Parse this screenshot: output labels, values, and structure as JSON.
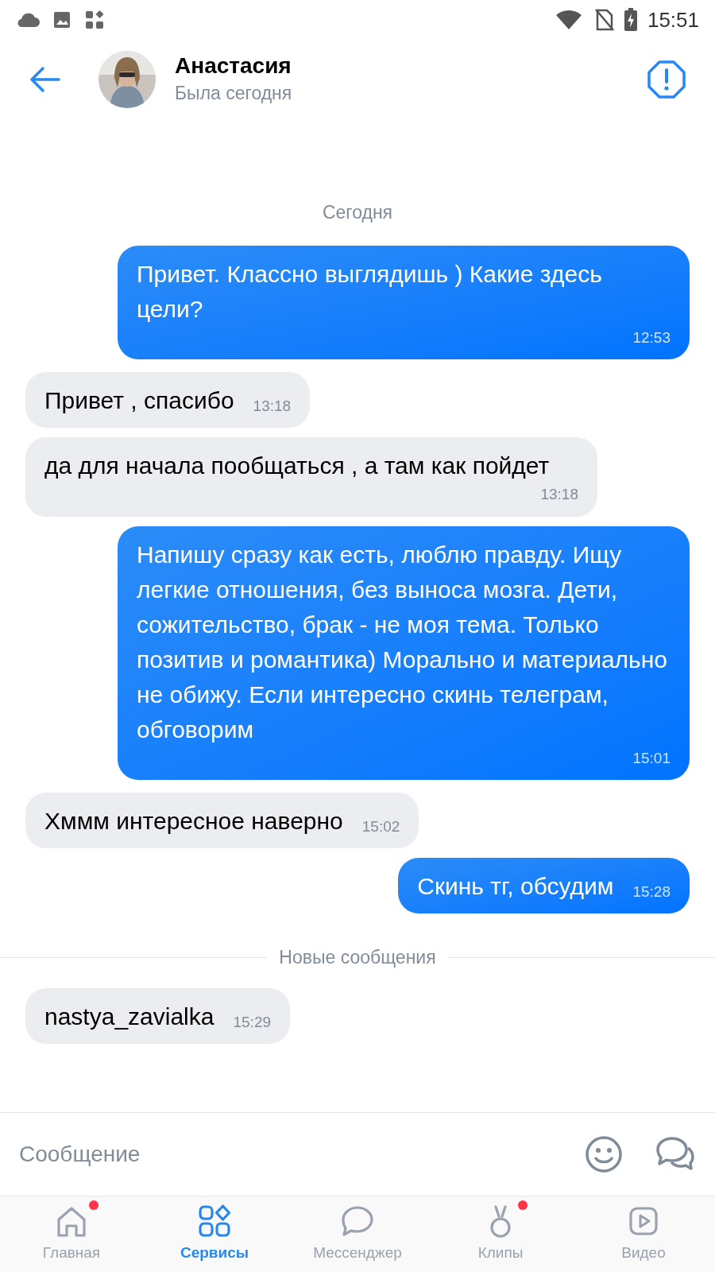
{
  "status_bar": {
    "time": "15:51"
  },
  "header": {
    "name": "Анастасия",
    "status": "Была сегодня"
  },
  "feed": [
    {
      "kind": "date",
      "text": "Сегодня"
    },
    {
      "kind": "out",
      "text": "Привет. Классно выглядишь ) Какие здесь цели?",
      "time": "12:53"
    },
    {
      "kind": "in",
      "text": "Привет , спасибо",
      "time": "13:18"
    },
    {
      "kind": "in",
      "text": "да для начала пообщаться , а там как пойдет",
      "time": "13:18"
    },
    {
      "kind": "out",
      "text": "Напишу сразу как есть, люблю правду. Ищу легкие отношения, без выноса мозга. Дети, сожительство, брак - не моя тема. Только позитив и романтика) Морально и материально не обижу. Если интересно скинь телеграм, обговорим",
      "time": "15:01"
    },
    {
      "kind": "in",
      "text": "Хммм интересное наверно",
      "time": "15:02"
    },
    {
      "kind": "out",
      "text": "Скинь тг, обсудим",
      "time": "15:28"
    },
    {
      "kind": "divider",
      "text": "Новые сообщения"
    },
    {
      "kind": "in",
      "text": "nastya_zavialka",
      "time": "15:29"
    }
  ],
  "composer": {
    "placeholder": "Сообщение"
  },
  "nav": [
    {
      "label": "Главная",
      "kind": "home",
      "selected": false,
      "badge": true
    },
    {
      "label": "Сервисы",
      "kind": "services",
      "selected": true,
      "badge": false
    },
    {
      "label": "Мессенджер",
      "kind": "chat",
      "selected": false,
      "badge": false
    },
    {
      "label": "Клипы",
      "kind": "clips",
      "selected": false,
      "badge": true
    },
    {
      "label": "Видео",
      "kind": "video",
      "selected": false,
      "badge": false
    }
  ]
}
